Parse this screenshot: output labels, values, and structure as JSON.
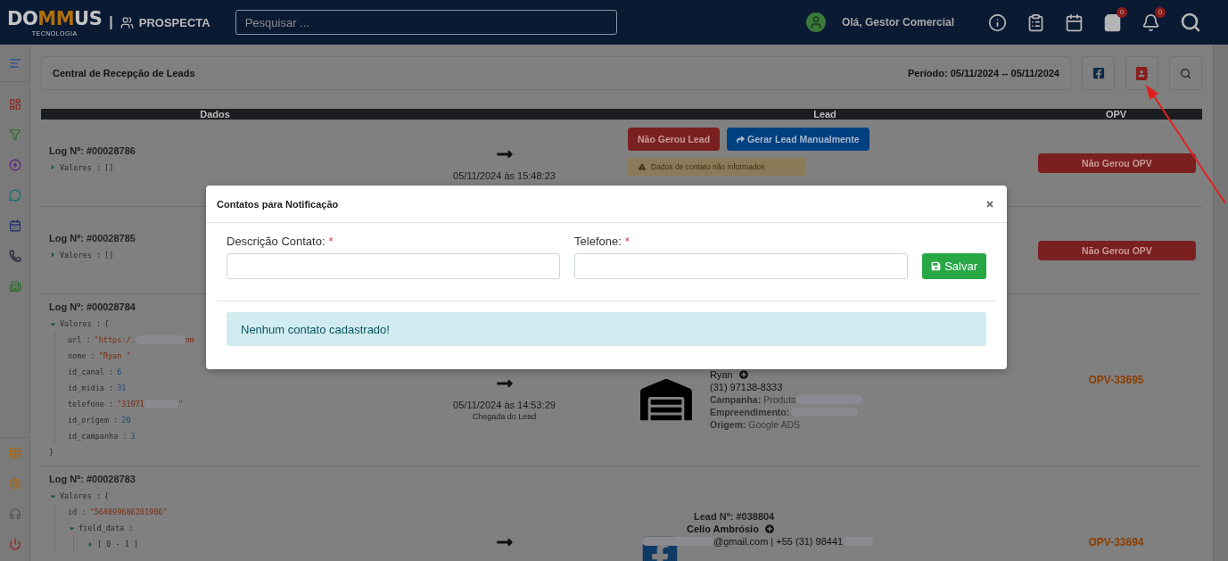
{
  "header": {
    "logo_left": "DO",
    "logo_mid": "MM",
    "logo_right": "US",
    "logo_tagline": "TECNOLOGIA",
    "separator": "|",
    "module": "PROSPECTA",
    "search": {
      "placeholder": "Pesquisar ..."
    },
    "greeting": "Olá, Gestor Comercial",
    "badges": [
      {
        "kind": "bag",
        "count": "0"
      },
      {
        "kind": "bell",
        "count": "0"
      }
    ]
  },
  "page": {
    "title": "Central de Recepção de Leads",
    "period": "Período: 05/11/2024 -- 05/11/2024"
  },
  "table": {
    "columns": [
      {
        "label": "Dados"
      },
      {
        "label": "Lead"
      },
      {
        "label": "OPV"
      }
    ],
    "rows": [
      {
        "log": "Log Nº: #00028786",
        "values": {
          "key": "Valores :",
          "expanded": false,
          "summary": "[]"
        },
        "time": "05/11/2024 às 15:48:23",
        "lead": {
          "kind": "actions",
          "buttons": [
            {
              "kind": "danger",
              "text": "Não Gerou Lead"
            },
            {
              "kind": "primary",
              "text": "Gerar Lead Manualmente"
            }
          ],
          "warning": "Dados de contato não informados"
        },
        "opv": {
          "kind": "button",
          "text": "Não Gerou OPV"
        }
      },
      {
        "log": "Log Nº: #00028785",
        "values": {
          "key": "Valores :",
          "expanded": false,
          "summary": "[]"
        },
        "opv": {
          "kind": "button",
          "text": "Não Gerou OPV"
        }
      },
      {
        "log": "Log Nº: #00028784",
        "values": {
          "key": "Valores :",
          "expanded": true,
          "open": "{",
          "close": "}",
          "children": [
            {
              "kind": "string",
              "key": "url :",
              "value": "\"https:/.",
              "redacted": true,
              "tail": "om"
            },
            {
              "kind": "string",
              "key": "nome :",
              "value": "\"Ryan \""
            },
            {
              "kind": "number",
              "key": "id_canal :",
              "value": "6"
            },
            {
              "kind": "number",
              "key": "id_midia :",
              "value": "31"
            },
            {
              "kind": "string",
              "key": "telefone :",
              "value": "\"31971",
              "redacted": true,
              "tail": "\""
            },
            {
              "kind": "number",
              "key": "id_origem :",
              "value": "20"
            },
            {
              "kind": "number",
              "key": "id_campanha :",
              "value": "3"
            }
          ]
        },
        "time": "05/11/2024 às 14:53:29",
        "time_caption": "Chegada do Lead",
        "lead": {
          "kind": "site",
          "name": "Ryan",
          "phone": "(31) 97138-8333",
          "details": [
            {
              "label": "Campanha:",
              "value": "Produto",
              "redacted": true
            },
            {
              "label": "Empreendimento:",
              "redacted": true
            },
            {
              "label": "Origem:",
              "value": "Google ADS",
              "redacted": false
            }
          ]
        },
        "opv": {
          "kind": "link",
          "text": "OPV-33695"
        }
      },
      {
        "log": "Log Nº: #00028783",
        "values": {
          "key": "Valores :",
          "expanded": true,
          "open": "{",
          "children": [
            {
              "kind": "string",
              "key": "id :",
              "value": "\"564099686201906\""
            },
            {
              "key": "field_data :",
              "expanded": true,
              "children": [
                {
                  "key": "[ 0 - 1 ]",
                  "expanded": false
                }
              ]
            }
          ]
        },
        "lead": {
          "kind": "social",
          "number": "Lead Nº: #038804",
          "name": "Celio Ambrósio",
          "contact": "@gmail.com | +55 (31) 98441",
          "redacted": true
        },
        "opv": {
          "kind": "link",
          "text": "OPV-33694"
        }
      }
    ]
  },
  "modal": {
    "title": "Contatos para Notificação",
    "fields": [
      {
        "label": "Descrição Contato:",
        "required_mark": "*"
      },
      {
        "label": "Telefone:",
        "required_mark": "*"
      }
    ],
    "save": "Salvar",
    "alert": "Nenhum contato cadastrado!"
  }
}
